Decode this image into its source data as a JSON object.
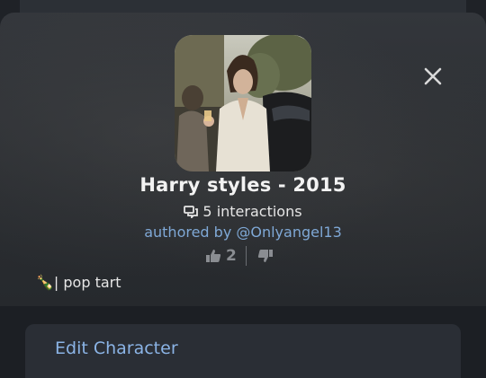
{
  "character": {
    "name": "Harry styles - 2015",
    "interactions": "5 interactions",
    "author": "authored by @Onlyangel13",
    "likes": "2",
    "tagline": "🍾| pop tart"
  },
  "actions": {
    "edit_label": "Edit Character"
  },
  "icons": {
    "close": "close-icon",
    "chat": "chat-bubbles-icon",
    "like": "thumbs-up-icon",
    "dislike": "thumbs-down-icon"
  },
  "colors": {
    "link_blue": "#7fa8d6",
    "button_text": "#8bb4e6",
    "vote_gray": "#8a8d92"
  }
}
